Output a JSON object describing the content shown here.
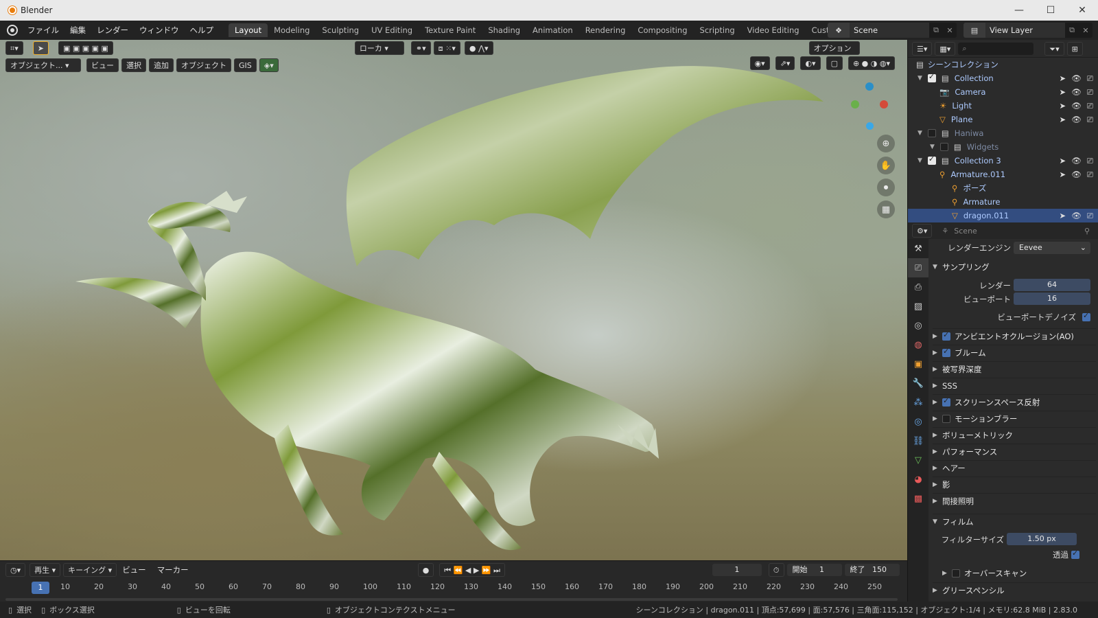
{
  "window": {
    "title": "Blender",
    "min": "—",
    "max": "☐",
    "close": "✕"
  },
  "menu": [
    "ファイル",
    "編集",
    "レンダー",
    "ウィンドウ",
    "ヘルプ"
  ],
  "workspaces": [
    "Layout",
    "Modeling",
    "Sculpting",
    "UV Editing",
    "Texture Paint",
    "Shading",
    "Animation",
    "Rendering",
    "Compositing",
    "Scripting",
    "Video Editing",
    "Custom"
  ],
  "scene": {
    "name": "Scene",
    "view_layer": "View Layer"
  },
  "viewport": {
    "mode": "オブジェクト...",
    "menus": [
      "ビュー",
      "選択",
      "追加",
      "オブジェクト",
      "GIS"
    ],
    "transform": "ローカ",
    "options": "オプション"
  },
  "outliner": {
    "title": "シーンコレクション",
    "rows": [
      {
        "label": "Collection",
        "indent": 0,
        "checked": true
      },
      {
        "label": "Camera",
        "indent": 1
      },
      {
        "label": "Light",
        "indent": 1
      },
      {
        "label": "Plane",
        "indent": 1
      },
      {
        "label": "Haniwa",
        "indent": 0,
        "checked": false
      },
      {
        "label": "Widgets",
        "indent": 1,
        "checked": false
      },
      {
        "label": "Collection 3",
        "indent": 0,
        "checked": true
      },
      {
        "label": "Armature.011",
        "indent": 1
      },
      {
        "label": "ポーズ",
        "indent": 2
      },
      {
        "label": "Armature",
        "indent": 2
      },
      {
        "label": "dragon.011",
        "indent": 2,
        "selected": true
      }
    ]
  },
  "properties": {
    "context": "Scene",
    "engine_label": "レンダーエンジン",
    "engine": "Eevee",
    "sampling": "サンプリング",
    "render_label": "レンダー",
    "render": "64",
    "viewport_label": "ビューポート",
    "viewport_val": "16",
    "denoise": "ビューポートデノイズ",
    "sections": [
      {
        "label": "アンビエントオクルージョン(AO)",
        "check": "on"
      },
      {
        "label": "ブルーム",
        "check": "on"
      },
      {
        "label": "被写界深度",
        "check": "none"
      },
      {
        "label": "SSS",
        "check": "none"
      },
      {
        "label": "スクリーンスペース反射",
        "check": "on"
      },
      {
        "label": "モーションブラー",
        "check": "off"
      },
      {
        "label": "ボリューメトリック",
        "check": "none"
      },
      {
        "label": "パフォーマンス",
        "check": "none"
      },
      {
        "label": "ヘアー",
        "check": "none"
      },
      {
        "label": "影",
        "check": "none"
      },
      {
        "label": "間接照明",
        "check": "none"
      }
    ],
    "film": "フィルム",
    "filter_label": "フィルターサイズ",
    "filter": "1.50 px",
    "transparent": "透過",
    "overscan": "オーバースキャン",
    "grease": "グリースペンシル"
  },
  "timeline": {
    "play": "再生",
    "keying": "キーイング",
    "view": "ビュー",
    "marker": "マーカー",
    "current": "1",
    "start_label": "開始",
    "start": "1",
    "end_label": "終了",
    "end": "150",
    "ticks": [
      "10",
      "20",
      "30",
      "40",
      "50",
      "60",
      "70",
      "80",
      "90",
      "100",
      "110",
      "120",
      "130",
      "140",
      "150",
      "160",
      "170",
      "180",
      "190",
      "200",
      "210",
      "220",
      "230",
      "240",
      "250"
    ]
  },
  "status": {
    "select": "選択",
    "box": "ボックス選択",
    "rotate": "ビューを回転",
    "context": "オブジェクトコンテクストメニュー",
    "info": "シーンコレクション | dragon.011 | 頂点:57,699 | 面:57,576 | 三角面:115,152 | オブジェクト:1/4 | メモリ:62.8 MiB | 2.83.0"
  }
}
